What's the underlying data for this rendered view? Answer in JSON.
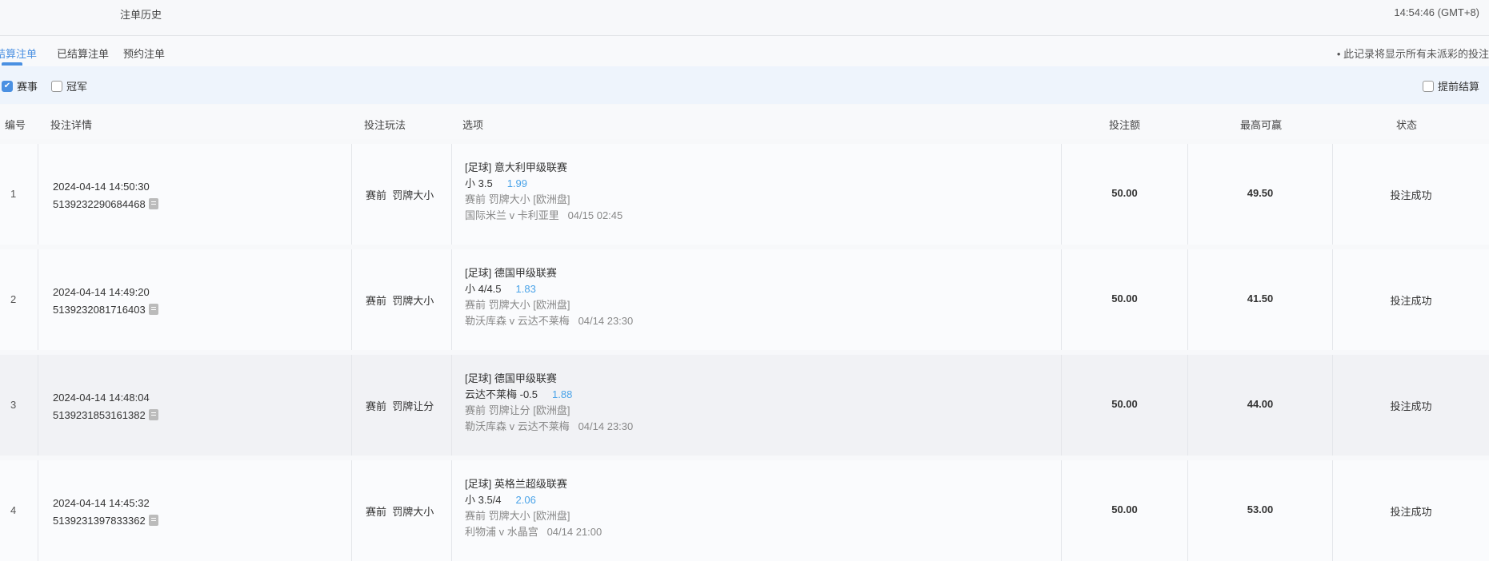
{
  "header": {
    "title": "注单历史",
    "time": "14:54:46 (GMT+8)"
  },
  "tabs": [
    {
      "label": "结算注单"
    },
    {
      "label": "已结算注单"
    },
    {
      "label": "预约注单"
    }
  ],
  "note": "• 此记录将显示所有未派彩的投注",
  "filters": {
    "match": "赛事",
    "outright": "冠军",
    "cashout": "提前结算"
  },
  "columns": [
    "编号",
    "投注详情",
    "投注玩法",
    "选项",
    "投注额",
    "最高可赢",
    "状态"
  ],
  "rows": [
    {
      "no": "1",
      "datetime": "2024-04-14 14:50:30",
      "id": "5139232290684468",
      "play": "赛前  罚牌大小",
      "league": "[足球] 意大利甲级联赛",
      "pick": "小 3.5",
      "odds": "1.99",
      "market": "赛前 罚牌大小 [欧洲盘]",
      "match": "国际米兰 v 卡利亚里",
      "kickoff": "04/15 02:45",
      "stake": "50.00",
      "max_win": "49.50",
      "status": "投注成功"
    },
    {
      "no": "2",
      "datetime": "2024-04-14 14:49:20",
      "id": "5139232081716403",
      "play": "赛前  罚牌大小",
      "league": "[足球] 德国甲级联赛",
      "pick": "小 4/4.5",
      "odds": "1.83",
      "market": "赛前 罚牌大小 [欧洲盘]",
      "match": "勒沃库森 v 云达不莱梅",
      "kickoff": "04/14 23:30",
      "stake": "50.00",
      "max_win": "41.50",
      "status": "投注成功"
    },
    {
      "no": "3",
      "datetime": "2024-04-14 14:48:04",
      "id": "5139231853161382",
      "play": "赛前  罚牌让分",
      "league": "[足球] 德国甲级联赛",
      "pick": "云达不莱梅 -0.5",
      "odds": "1.88",
      "market": "赛前 罚牌让分 [欧洲盘]",
      "match": "勒沃库森 v 云达不莱梅",
      "kickoff": "04/14 23:30",
      "stake": "50.00",
      "max_win": "44.00",
      "status": "投注成功"
    },
    {
      "no": "4",
      "datetime": "2024-04-14 14:45:32",
      "id": "5139231397833362",
      "play": "赛前  罚牌大小",
      "league": "[足球] 英格兰超级联赛",
      "pick": "小 3.5/4",
      "odds": "2.06",
      "market": "赛前 罚牌大小 [欧洲盘]",
      "match": "利物浦 v 水晶宫",
      "kickoff": "04/14 21:00",
      "stake": "50.00",
      "max_win": "53.00",
      "status": "投注成功"
    }
  ]
}
